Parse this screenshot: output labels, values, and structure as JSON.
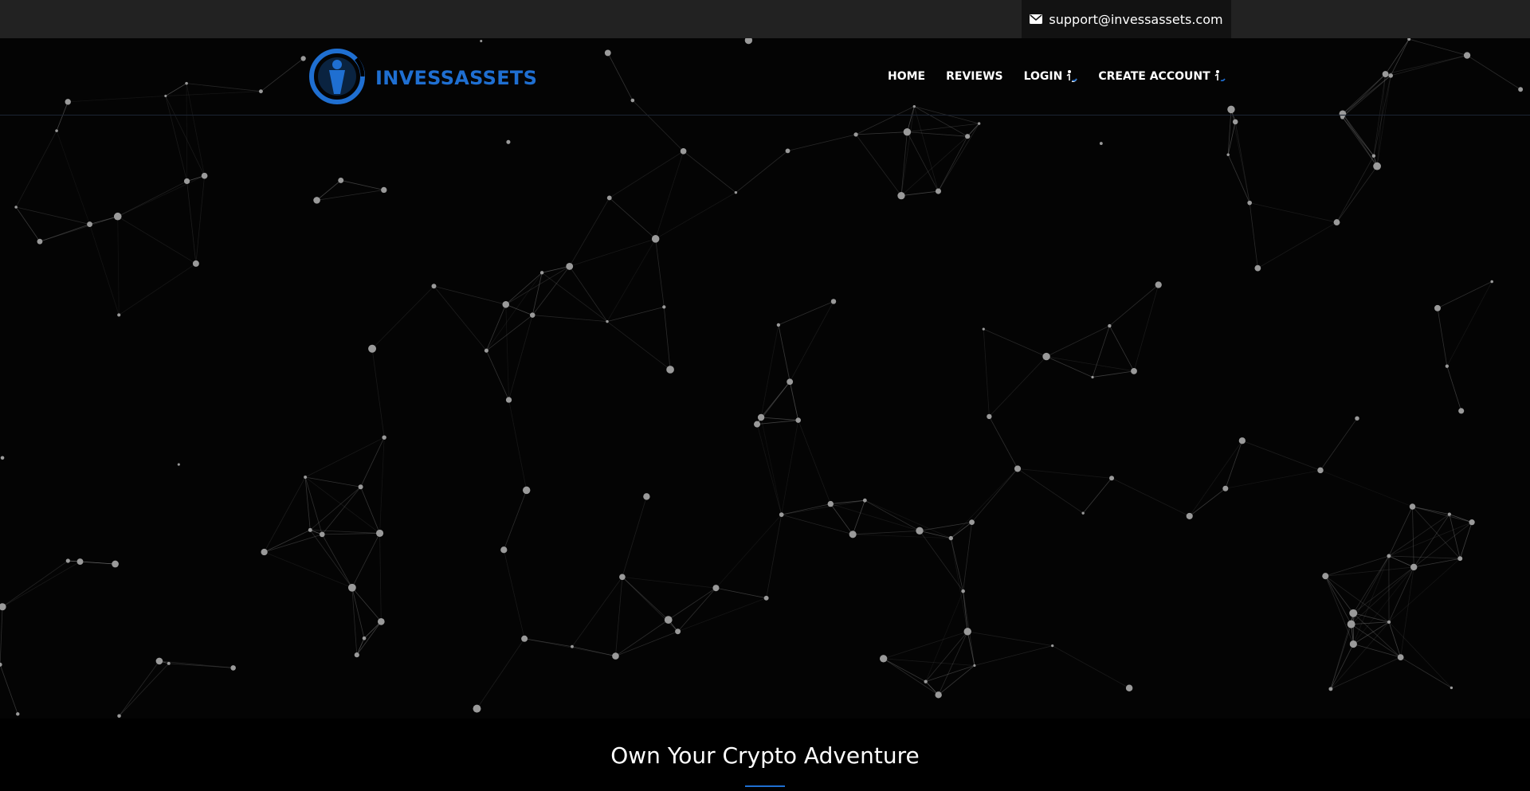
{
  "topbar": {
    "email": "support@invessassets.com",
    "email_icon": "envelope-icon"
  },
  "logo": {
    "text": "INVESSASSETS",
    "icon": "person-circle-logo-icon"
  },
  "nav": {
    "items": [
      {
        "label": "HOME",
        "icon": null
      },
      {
        "label": "REVIEWS",
        "icon": null
      },
      {
        "label": "LOGIN",
        "icon": "spinner-icon"
      },
      {
        "label": "CREATE ACCOUNT",
        "icon": "spinner-icon"
      }
    ]
  },
  "hero": {
    "headline": "Own Your Crypto Adventure"
  },
  "colors": {
    "brand": "#1f6fd1",
    "topbar": "#222222",
    "support_bg": "#121212",
    "background": "#040404"
  }
}
